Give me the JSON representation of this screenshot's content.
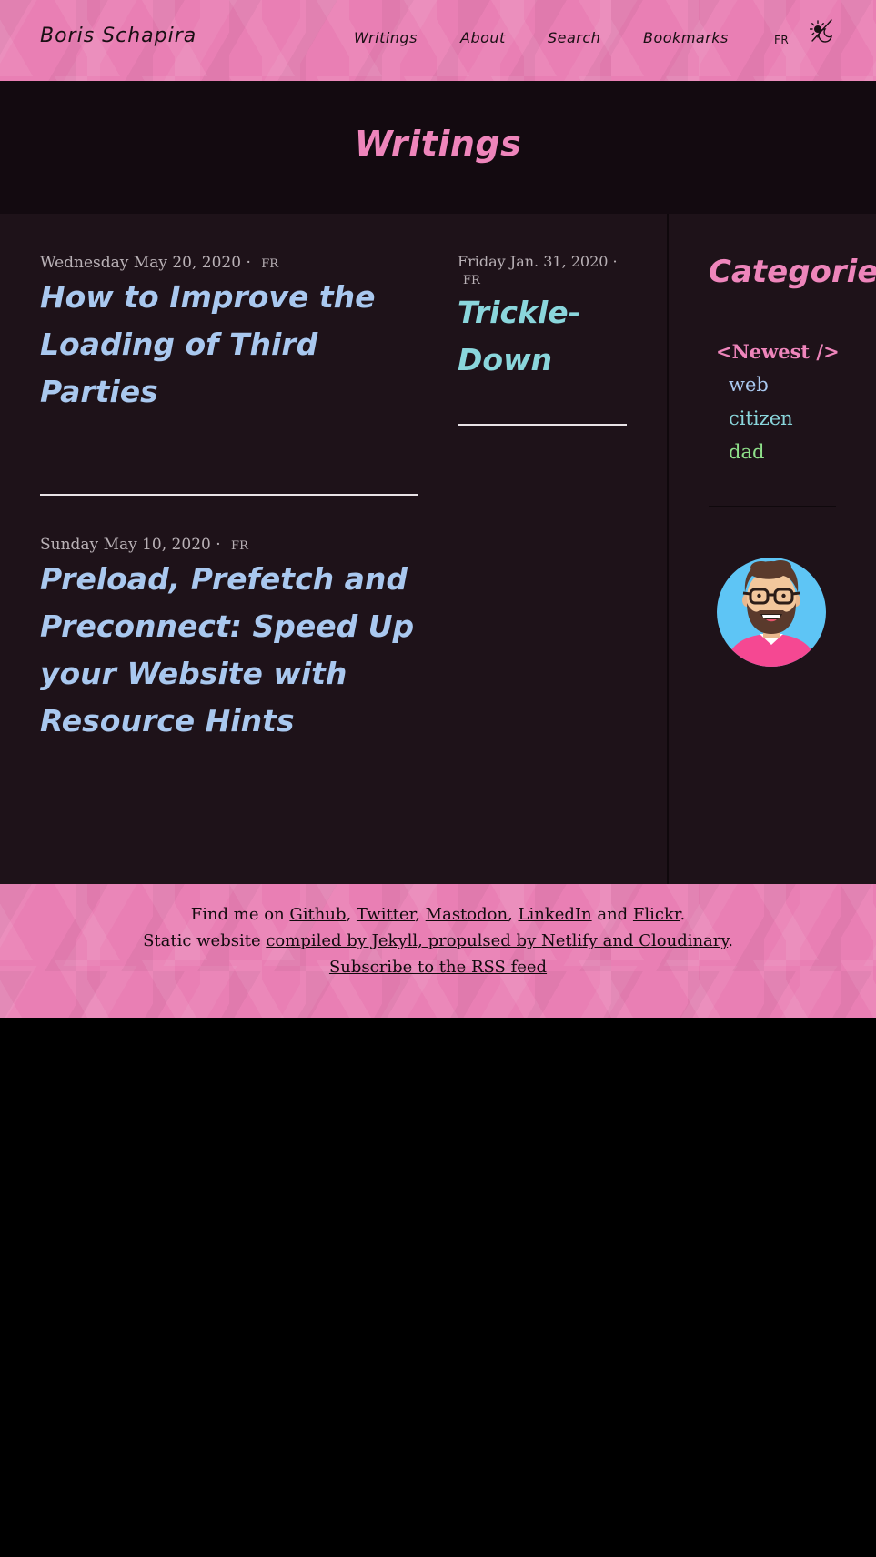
{
  "header": {
    "site_name": "Boris Schapira",
    "nav": [
      {
        "label": "Writings"
      },
      {
        "label": "About"
      },
      {
        "label": "Search"
      },
      {
        "label": "Bookmarks"
      }
    ],
    "lang_switch": "FR",
    "theme_icon": "sun-moon-icon"
  },
  "hero": {
    "title": "Writings"
  },
  "posts": [
    {
      "date": "Wednesday May 20, 2020",
      "sep": "·",
      "lang": "FR",
      "title": "How to Improve the Loading of Third Parties"
    },
    {
      "date": "Friday Jan. 31, 2020",
      "sep": "·",
      "lang": "FR",
      "title": "Trickle-Down"
    },
    {
      "date": "Sunday May 10, 2020",
      "sep": "·",
      "lang": "FR",
      "title": "Preload, Prefetch and Preconnect: Speed Up your Website with Resource Hints"
    }
  ],
  "sidebar": {
    "heading": "Categories",
    "categories": [
      {
        "label": "<Newest />",
        "color": "#ee85bb"
      },
      {
        "label": "web",
        "color": "#a9c8ef"
      },
      {
        "label": "citizen",
        "color": "#8ad6dc"
      },
      {
        "label": "dad",
        "color": "#8fe08a"
      }
    ],
    "avatar_icon": "avatar-illustration"
  },
  "footer": {
    "line1": {
      "prefix": "Find me on ",
      "links": [
        "Github",
        "Twitter",
        "Mastodon",
        "LinkedIn",
        "Flickr"
      ],
      "comma": ", ",
      "and": " and ",
      "end": "."
    },
    "line2": {
      "prefix": "Static website ",
      "link": "compiled by Jekyll, propulsed by Netlify and Cloudinary",
      "end": "."
    },
    "line3": {
      "link": "Subscribe to the RSS feed"
    }
  },
  "colors": {
    "brand_pink": "#ee85bb",
    "band_pink": "#e97fb4",
    "title_blue": "#a9c8ef",
    "title_cyan": "#8ad6dc",
    "tag_green": "#8fe08a",
    "content_bg": "#1e1219",
    "hero_bg": "#130a10"
  }
}
